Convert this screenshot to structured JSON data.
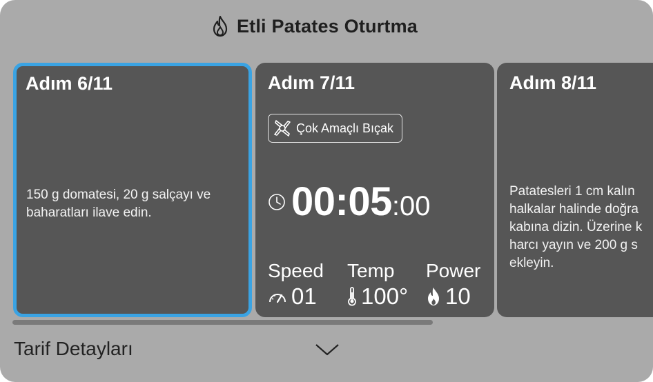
{
  "header": {
    "title": "Etli Patates Oturtma",
    "icon": "flame-outline-icon"
  },
  "cards": [
    {
      "step": "Adım 6/11",
      "description": "150 g domatesi, 20 g salçayı ve baharatları ilave edin."
    },
    {
      "step": "Adım 7/11",
      "tool": "Çok Amaçlı Bıçak",
      "timer": {
        "main": "00:05",
        "seconds": ":00"
      },
      "stats": {
        "speed": {
          "label": "Speed",
          "value": "01"
        },
        "temp": {
          "label": "Temp",
          "value": "100°"
        },
        "power": {
          "label": "Power",
          "value": "10"
        }
      }
    },
    {
      "step": "Adım 8/11",
      "description": "Patatesleri 1 cm kalın halkalar halinde doğra kabına dizin. Üzerine k harcı yayın ve 200 g s ekleyin."
    }
  ],
  "footer": {
    "details_label": "Tarif Detayları"
  },
  "colors": {
    "active_border": "#3aa3e3",
    "card_bg": "#565656",
    "background": "#aaaaaa"
  }
}
